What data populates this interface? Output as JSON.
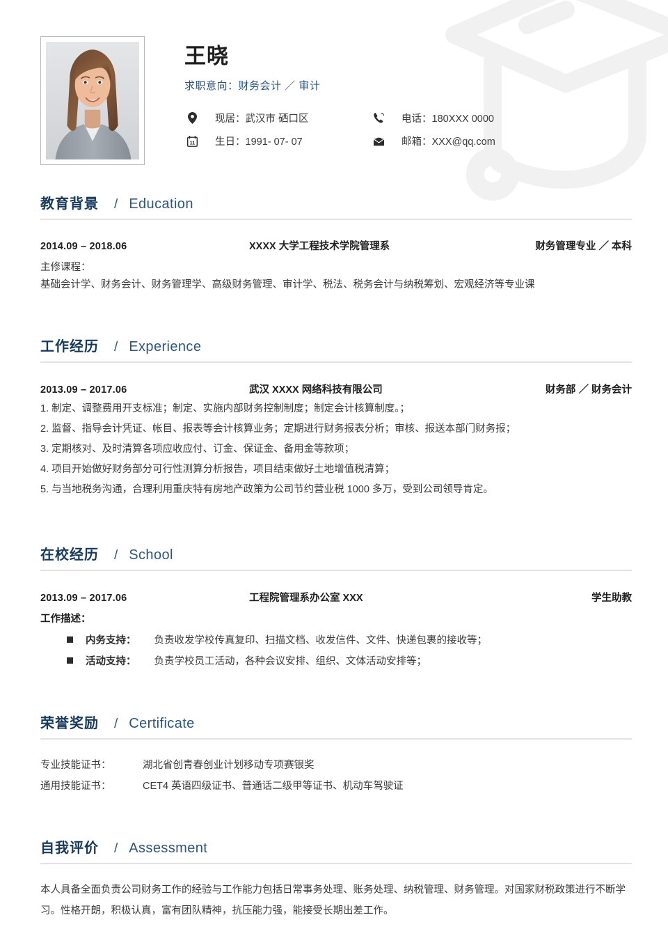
{
  "colors": {
    "heading_cn": "#16395c",
    "heading_en": "#2d5580",
    "body": "#3b3b3b",
    "divider": "#e2e2e2",
    "name": "#1f1f1f"
  },
  "watermark": {
    "icon": "graduation-cap-icon"
  },
  "header": {
    "photo": {
      "icon": "portrait-photo",
      "alt": "应聘者照片"
    },
    "name": "王晓",
    "objective": "求职意向：财务会计 ／ 审计",
    "contacts": [
      {
        "icon": "location-pin-icon",
        "text": "现居：武汉市 硒口区"
      },
      {
        "icon": "phone-icon",
        "text": "电话：180XXX 0000"
      },
      {
        "icon": "calendar-icon",
        "text": "生日：1991- 07- 07",
        "calendar_day": "11"
      },
      {
        "icon": "envelope-icon",
        "text": "邮箱：XXX@qq.com"
      }
    ]
  },
  "sections": [
    {
      "id": "education",
      "cn": "教育背景",
      "slash": "/",
      "en": "Education",
      "entry": {
        "date": "2014.09 – 2018.06",
        "org": "XXXX 大学工程技术学院管理系",
        "role": "财务管理专业 ／ 本科"
      },
      "sub_label": "主修课程：",
      "lines": [
        "基础会计学、财务会计、财务管理学、高级财务管理、审计学、税法、税务会计与纳税筹划、宏观经济等专业课"
      ]
    },
    {
      "id": "experience",
      "cn": "工作经历",
      "slash": "/",
      "en": "Experience",
      "entry": {
        "date": "2013.09 – 2017.06",
        "org": "武汉 XXXX 网络科技有限公司",
        "role": "财务部 ／ 财务会计"
      },
      "items": [
        "1. 制定、调整费用开支标准；制定、实施内部财务控制制度；制定会计核算制度。；",
        "2. 监督、指导会计凭证、帐目、报表等会计核算业务；定期进行财务报表分析；审核、报送本部门财务报；",
        "3. 定期核对、及时清算各项应收应付、订金、保证金、备用金等款项；",
        "4. 项目开始做好财务部分可行性测算分析报告，项目结束做好土地增值税清算；",
        "5. 与当地税务沟通，合理利用重庆特有房地产政策为公司节约营业税 1000 多万，受到公司领导肯定。"
      ]
    },
    {
      "id": "school",
      "cn": "在校经历",
      "slash": "/",
      "en": "School",
      "entry": {
        "date": "2013.09 – 2017.06",
        "org": "工程院管理系办公室 XXX",
        "role": "学生助教"
      },
      "sub_label": "工作描述：",
      "bullets": [
        {
          "label": "内务支持：",
          "text": "负责收发学校传真复印、扫描文档、收发信件、文件、快递包裹的接收等；"
        },
        {
          "label": "活动支持：",
          "text": "负责学校员工活动，各种会议安排、组织、文体活动安排等；"
        }
      ]
    },
    {
      "id": "certificate",
      "cn": "荣誉奖励",
      "slash": "/",
      "en": "Certificate",
      "rows": [
        {
          "label": "专业技能证书：",
          "value": "湖北省创青春创业计划移动专项赛银奖"
        },
        {
          "label": "通用技能证书：",
          "value": "CET4 英语四级证书、普通话二级甲等证书、机动车驾驶证"
        }
      ]
    },
    {
      "id": "assessment",
      "cn": "自我评价",
      "slash": "/",
      "en": "Assessment",
      "paragraph": "本人具备全面负责公司财务工作的经验与工作能力包括日常事务处理、账务处理、纳税管理、财务管理。对国家财税政策进行不断学习。性格开朗，积极认真，富有团队精神，抗压能力强，能接受长期出差工作。"
    }
  ]
}
